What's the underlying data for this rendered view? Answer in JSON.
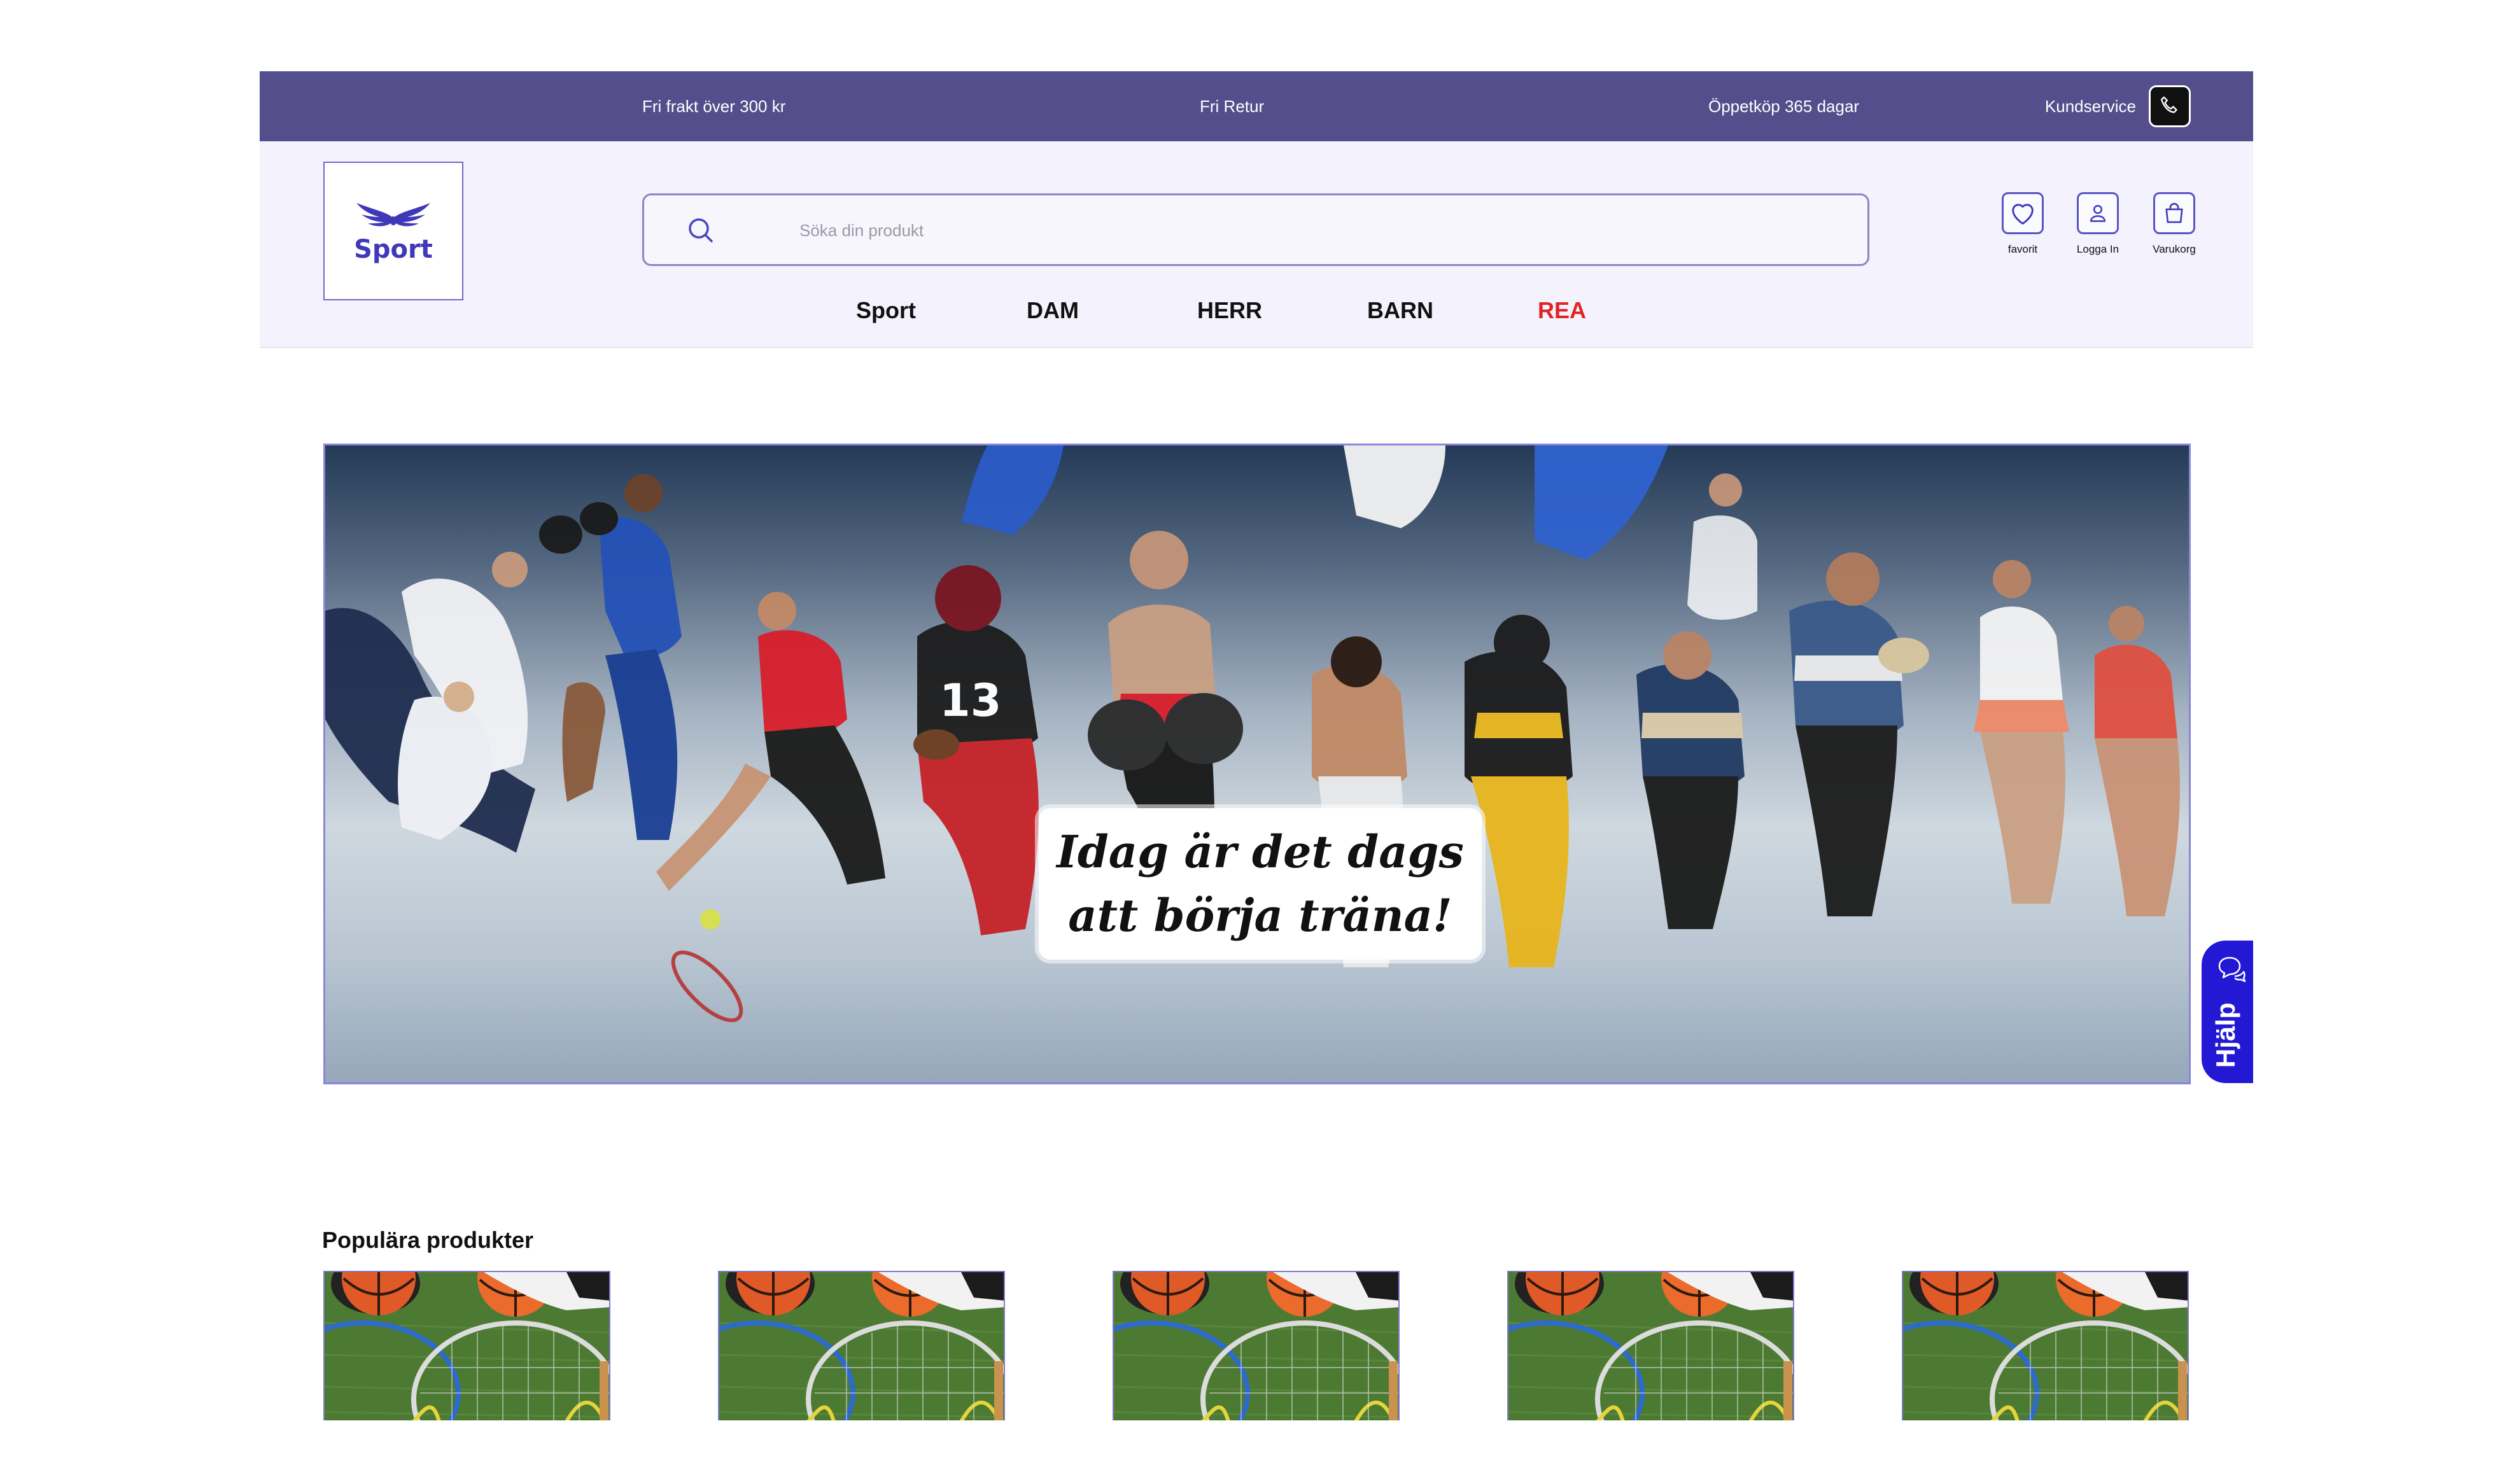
{
  "topbar": {
    "free_shipping": "Fri frakt över 300 kr",
    "free_return": "Fri Retur",
    "open_purchase": "Öppetköp 365 dagar",
    "customer_service": "Kundservice"
  },
  "logo": {
    "text": "Sport"
  },
  "search": {
    "placeholder": "Söka din produkt",
    "value": ""
  },
  "header_icons": {
    "favorites": "favorit",
    "login": "Logga In",
    "cart": "Varukorg"
  },
  "nav": {
    "items": [
      {
        "label": "Sport"
      },
      {
        "label": "DAM"
      },
      {
        "label": "HERR"
      },
      {
        "label": "BARN"
      },
      {
        "label": "REA"
      }
    ]
  },
  "hero": {
    "line1": "Idag är det dags",
    "line2": "att börja träna!"
  },
  "help": {
    "label": "Hjälp"
  },
  "popular": {
    "title": "Populära produkter",
    "products": [
      {
        "image": "sport-equipment-photo"
      },
      {
        "image": "sport-equipment-photo"
      },
      {
        "image": "sport-equipment-photo"
      },
      {
        "image": "sport-equipment-photo"
      },
      {
        "image": "sport-equipment-photo"
      }
    ]
  },
  "colors": {
    "topbar": "#544f8c",
    "header_bg": "#f3f2fd",
    "accent": "#3f39b8",
    "sale": "#e02424",
    "help": "#2318d4"
  }
}
